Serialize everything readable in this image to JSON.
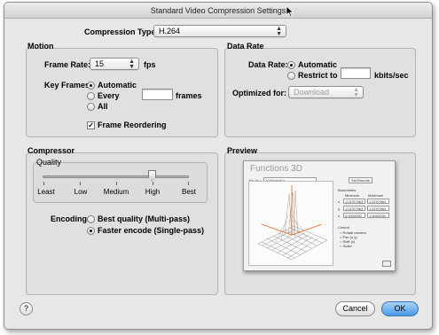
{
  "window": {
    "title": "Standard Video Compression Settings"
  },
  "compression": {
    "label": "Compression Type:",
    "value": "H.264"
  },
  "motion": {
    "title": "Motion",
    "frame_rate_label": "Frame Rate:",
    "frame_rate_value": "15",
    "frame_rate_unit": "fps",
    "key_frames_label": "Key Frames:",
    "key_frames_options": [
      "Automatic",
      "Every",
      "All"
    ],
    "key_frames_selected": "Automatic",
    "key_frames_every_value": "",
    "key_frames_unit": "frames",
    "frame_reordering_label": "Frame Reordering",
    "frame_reordering_checked": true
  },
  "data_rate": {
    "title": "Data Rate",
    "label": "Data Rate:",
    "options": [
      "Automatic",
      "Restrict to"
    ],
    "selected": "Automatic",
    "restrict_value": "",
    "unit": "kbits/sec",
    "optimized_label": "Optimized for:",
    "optimized_value": "Download"
  },
  "compressor": {
    "title": "Compressor",
    "quality_title": "Quality",
    "quality_levels": [
      "Least",
      "Low",
      "Medium",
      "High",
      "Best"
    ],
    "quality_selected": "High",
    "encoding_label": "Encoding:",
    "encoding_options": [
      "Best quality (Multi-pass)",
      "Faster encode (Single-pass)"
    ],
    "encoding_selected": "Faster encode (Single-pass)"
  },
  "preview": {
    "title": "Preview",
    "app_title": "Functions 3D",
    "function_label": "f(x, y) =",
    "function_value": "10/(x*x+y*y)",
    "button_label": "Set Bounds",
    "boundaries_label": "Boundaries",
    "minimum_label": "Minimum",
    "maximum_label": "Maximum",
    "axis_rows": [
      {
        "axis": "x",
        "min": "-0.5707963",
        "max": "1.5707963"
      },
      {
        "axis": "y",
        "min": "-0.5707963",
        "max": "1.5707963"
      },
      {
        "axis": "z",
        "min": "0.0000000",
        "max": "1.0000000"
      }
    ],
    "control_label": "Control",
    "control_options": [
      "Rotate camera",
      "Pan (x,y)",
      "Shift (z)",
      "Scale"
    ]
  },
  "buttons": {
    "help": "?",
    "cancel": "Cancel",
    "ok": "OK"
  },
  "colors": {
    "accent": "#4a9ae8",
    "window_bg": "#e7e7e7"
  }
}
